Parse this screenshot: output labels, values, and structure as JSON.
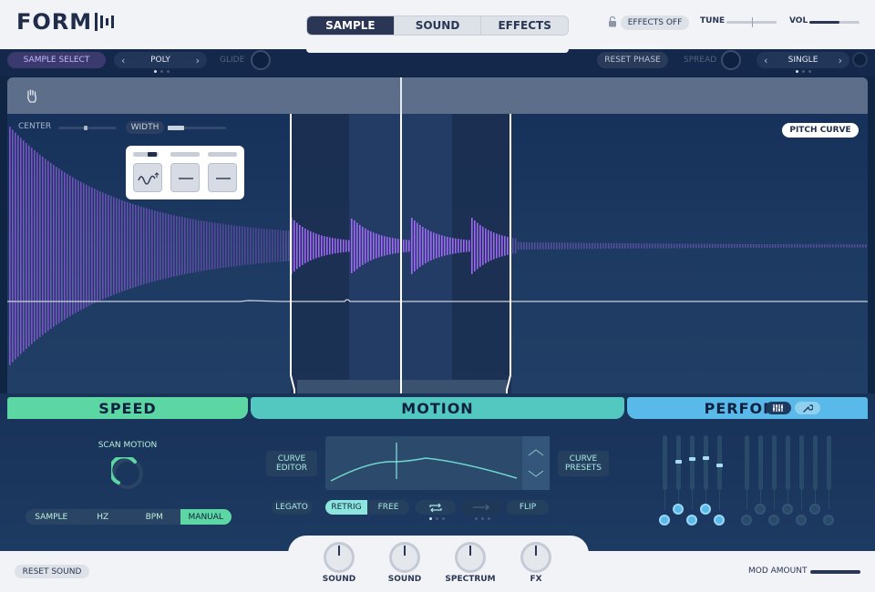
{
  "app": {
    "logo_text": "FORM"
  },
  "tabs": [
    {
      "label": "SAMPLE",
      "active": true
    },
    {
      "label": "SOUND",
      "active": false
    },
    {
      "label": "EFFECTS",
      "active": false
    }
  ],
  "header": {
    "effects_toggle_label": "EFFECTS OFF",
    "tune_label": "TUNE",
    "vol_label": "VOL",
    "vol_level": 0.6,
    "tune_level": 0.5
  },
  "controls": {
    "sample_select_label": "SAMPLE SELECT",
    "voice_mode": {
      "value": "POLY",
      "page": 1,
      "pages": 3
    },
    "glide_label": "GLIDE",
    "reset_phase_label": "RESET PHASE",
    "spread_label": "SPREAD",
    "unison_mode": {
      "value": "SINGLE",
      "page": 1,
      "pages": 3
    }
  },
  "wave": {
    "center_label": "CENTER",
    "width_label": "WIDTH",
    "pitch_curve_label": "PITCH CURVE"
  },
  "speed": {
    "title": "SPEED",
    "scan_label": "SCAN MOTION",
    "modes": [
      {
        "label": "SAMPLE",
        "active": false
      },
      {
        "label": "HZ",
        "active": false
      },
      {
        "label": "BPM",
        "active": false
      },
      {
        "label": "MANUAL",
        "active": true
      }
    ]
  },
  "motion": {
    "title": "MOTION",
    "curve_editor_line1": "CURVE",
    "curve_editor_line2": "EDITOR",
    "curve_presets_line1": "CURVE",
    "curve_presets_line2": "PRESETS",
    "legato_label": "LEGATO",
    "retrig_label": "RETRIG",
    "free_label": "FREE",
    "flip_label": "FLIP"
  },
  "perform": {
    "title": "PERFORM"
  },
  "footer": {
    "reset_sound_label": "RESET SOUND",
    "macros": [
      {
        "label": "SOUND"
      },
      {
        "label": "SOUND"
      },
      {
        "label": "SPECTRUM"
      },
      {
        "label": "FX"
      }
    ],
    "mod_amount_label": "MOD AMOUNT"
  },
  "colors": {
    "speed": "#5cd6a2",
    "motion": "#53c8c0",
    "perform": "#59b9e8",
    "wave": "#9a63e0",
    "background": "#102444"
  },
  "icons": {
    "lock": "lock-icon",
    "hand": "hand-grab-icon",
    "loop": "loop-icon",
    "arrow": "arrow-right-icon",
    "mixer": "mixer-icon",
    "wrench": "wrench-icon"
  }
}
